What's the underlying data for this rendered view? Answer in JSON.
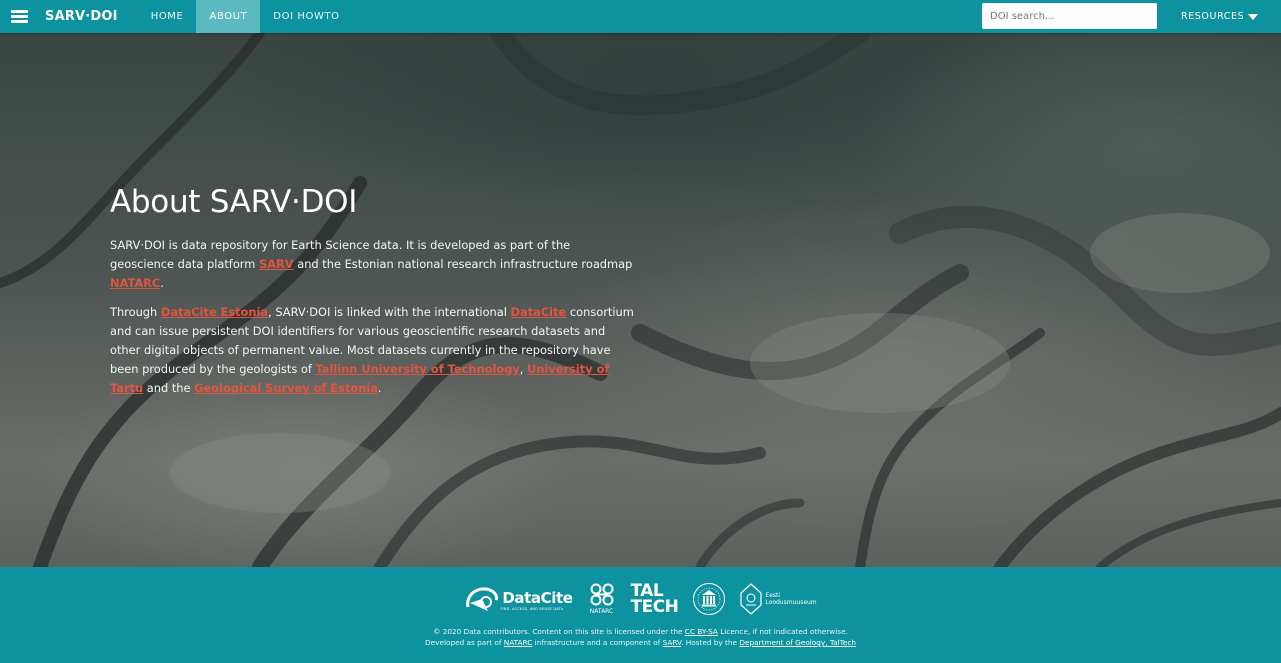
{
  "navbar": {
    "brand": "SARV·DOI",
    "items": [
      {
        "label": "HOME",
        "active": false
      },
      {
        "label": "ABOUT",
        "active": true
      },
      {
        "label": "DOI HOWTO",
        "active": false
      }
    ],
    "search_placeholder": "DOI search...",
    "resources_label": "RESOURCES"
  },
  "hero": {
    "title": "About SARV·DOI",
    "p1": {
      "t1": "SARV·DOI is data repository for Earth Science data. It is developed as part of the geoscience data platform ",
      "link_sarv": "SARV",
      "t2": " and the Estonian national research infrastructure roadmap ",
      "link_natarc": "NATARC",
      "t3": "."
    },
    "p2": {
      "t1": "Through ",
      "link_datacite_estonia": "DataCite Estonia",
      "t2": ", SARV·DOI is linked with the international ",
      "link_datacite": "DataCite",
      "t3": " consortium and can issue persistent DOI identifiers for various geoscientific research datasets and other digital objects of permanent value. Most datasets currently in the repository have been produced by the geologists of ",
      "link_taltech": "Tallinn University of Technology",
      "t4": ", ",
      "link_tartu": "University of Tartu",
      "t5": " and the ",
      "link_survey": "Geological Survey of Estonia",
      "t6": "."
    }
  },
  "footer": {
    "logos": {
      "datacite": "DataCite",
      "datacite_tagline": "FIND, ACCESS, AND REUSE DATA",
      "natarc": "NATARC",
      "taltech_line1": "TAL",
      "taltech_line2": "TECH",
      "loodus_line1": "Eesti",
      "loodus_line2": "Loodusmuuseum"
    },
    "line1": {
      "t1": "© 2020 Data contributors. Content on this site is licensed under the ",
      "link_license": "CC BY-SA",
      "t2": " Licence, if not indicated otherwise."
    },
    "line2": {
      "t1": "Developed as part of ",
      "link_natarc": "NATARC",
      "t2": " infrastructure and a component of ",
      "link_sarv": "SARV",
      "t3": ". Hosted by the ",
      "link_dept": "Department of Geology, TalTech"
    }
  },
  "colors": {
    "primary": "#0d939f",
    "active_tab": "#5bb9c1",
    "link": "#e2543f"
  }
}
